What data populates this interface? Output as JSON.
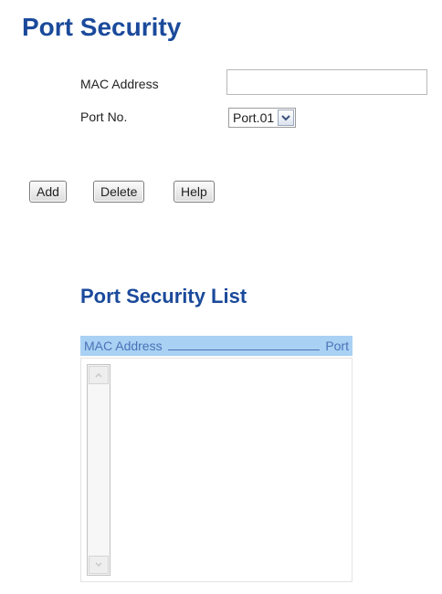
{
  "page": {
    "title": "Port Security"
  },
  "form": {
    "mac_label": "MAC Address",
    "mac_value": "",
    "port_label": "Port No.",
    "port_selected": "Port.01"
  },
  "buttons": {
    "add": "Add",
    "delete": "Delete",
    "help": "Help"
  },
  "list": {
    "title": "Port Security List",
    "columns": [
      "MAC Address",
      "Port"
    ],
    "rows": []
  },
  "icons": {
    "select_arrow": "chevron-down-icon",
    "scroll_up": "scroll-up-icon",
    "scroll_down": "scroll-down-icon"
  },
  "colors": {
    "title": "#1b4a9b",
    "list_header_bg": "#a9d1f3",
    "list_header_text": "#4a73b8"
  }
}
